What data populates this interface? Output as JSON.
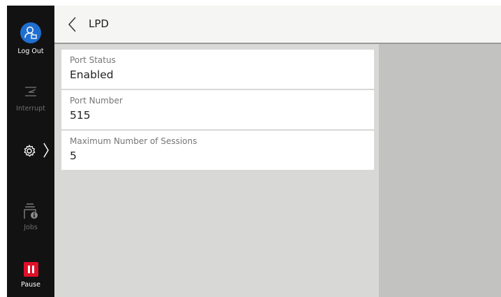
{
  "sidebar": {
    "logout_label": "Log Out",
    "interrupt_label": "Interrupt",
    "jobs_label": "Jobs",
    "pause_label": "Pause"
  },
  "header": {
    "title": "LPD"
  },
  "settings": [
    {
      "label": "Port Status",
      "value": "Enabled"
    },
    {
      "label": "Port Number",
      "value": "515"
    },
    {
      "label": "Maximum Number of Sessions",
      "value": "5"
    }
  ],
  "colors": {
    "logout_accent": "#1f6fd0",
    "pause_accent": "#e0102a",
    "sidebar_bg": "#121212"
  }
}
